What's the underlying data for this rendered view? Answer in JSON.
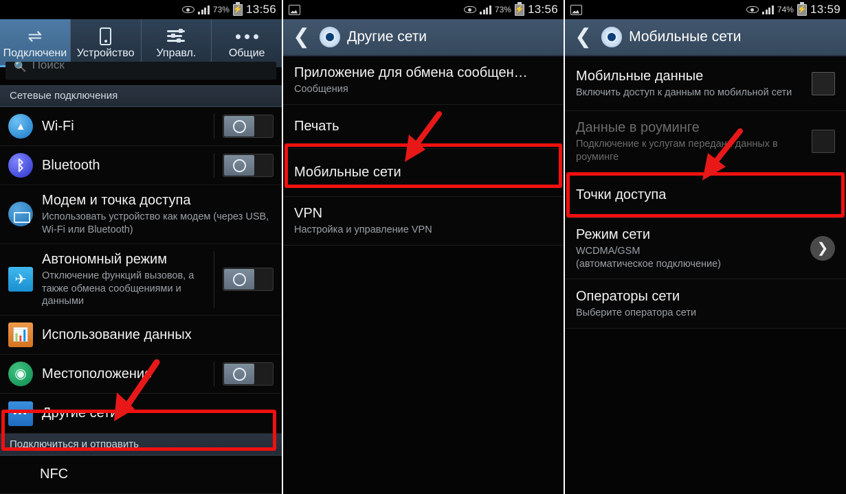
{
  "panels": [
    {
      "id": "connections",
      "status_bar": {
        "eye_icon": "eye-icon",
        "signal_icon": "signal-bars-icon",
        "battery_percent": "73%",
        "battery_icon": "battery-charging-icon",
        "time": "13:56"
      },
      "tabs": [
        {
          "label": "Подключени",
          "icon": "swap-arrows-icon",
          "active": true
        },
        {
          "label": "Устройство",
          "icon": "phone-icon",
          "active": false
        },
        {
          "label": "Управл.",
          "icon": "sliders-icon",
          "active": false
        },
        {
          "label": "Общие",
          "icon": "ellipsis-icon",
          "active": false
        }
      ],
      "search": {
        "placeholder": "Поиск",
        "icon": "search-icon"
      },
      "section_header": "Сетевые подключения",
      "rows": [
        {
          "title": "Wi-Fi",
          "sub": "",
          "icon": "wifi-icon",
          "control": "toggle",
          "state": "off"
        },
        {
          "title": "Bluetooth",
          "sub": "",
          "icon": "bluetooth-icon",
          "control": "toggle",
          "state": "off"
        },
        {
          "title": "Модем и точка доступа",
          "sub": "Использовать устройство как модем (через USB, Wi-Fi или Bluetooth)",
          "icon": "tethering-icon",
          "control": "none"
        },
        {
          "title": "Автономный режим",
          "sub": "Отключение функций вызовов, а также обмена сообщениями и данными",
          "icon": "airplane-icon",
          "control": "toggle",
          "state": "off"
        },
        {
          "title": "Использование данных",
          "sub": "",
          "icon": "data-usage-icon",
          "control": "none"
        },
        {
          "title": "Местоположение",
          "sub": "",
          "icon": "location-icon",
          "control": "toggle",
          "state": "off"
        },
        {
          "title": "Другие сети",
          "sub": "",
          "icon": "more-networks-icon",
          "control": "none",
          "highlighted": true
        }
      ],
      "section_header_2": "Подключиться и отправить",
      "rows_2": [
        {
          "title": "NFC",
          "sub": "",
          "icon": "none",
          "control": "none"
        }
      ]
    },
    {
      "id": "other-networks",
      "status_bar": {
        "image_icon": "image-notification-icon",
        "eye_icon": "eye-icon",
        "signal_icon": "signal-bars-icon",
        "battery_percent": "73%",
        "battery_icon": "battery-charging-icon",
        "time": "13:56"
      },
      "action_bar": {
        "back_icon": "back-chevron-icon",
        "app_icon": "settings-gear-icon",
        "title": "Другие сети"
      },
      "rows": [
        {
          "title": "Приложение для обмена сообщен…",
          "sub": "Сообщения"
        },
        {
          "title": "Печать",
          "sub": ""
        },
        {
          "title": "Мобильные сети",
          "sub": "",
          "highlighted": true
        },
        {
          "title": "VPN",
          "sub": "Настройка и управление VPN"
        }
      ]
    },
    {
      "id": "mobile-networks",
      "status_bar": {
        "image_icon": "image-notification-icon",
        "eye_icon": "eye-icon",
        "signal_icon": "signal-bars-icon",
        "battery_percent": "74%",
        "battery_icon": "battery-charging-icon",
        "time": "13:59"
      },
      "action_bar": {
        "back_icon": "back-chevron-icon",
        "app_icon": "settings-gear-icon",
        "title": "Мобильные сети"
      },
      "rows": [
        {
          "title": "Мобильные данные",
          "sub": "Включить доступ к данным по мобильной сети",
          "control": "checkbox",
          "state": "unchecked",
          "dim": false
        },
        {
          "title": "Данные в роуминге",
          "sub": "Подключение к услугам передани данных в роуминге",
          "control": "checkbox",
          "state": "unchecked",
          "dim": true
        },
        {
          "title": "Точки доступа",
          "sub": "",
          "control": "none",
          "highlighted": true
        },
        {
          "title": "Режим сети",
          "sub": "WCDMA/GSM\n(автоматическое подключение)",
          "control": "chevron"
        },
        {
          "title": "Операторы сети",
          "sub": "Выберите оператора сети",
          "control": "none"
        }
      ]
    }
  ],
  "annotations": {
    "highlight_color": "#f01010",
    "arrow_color": "#e81818",
    "items": [
      {
        "target": "Другие сети",
        "panel": "connections"
      },
      {
        "target": "Мобильные сети",
        "panel": "other-networks"
      },
      {
        "target": "Точки доступа",
        "panel": "mobile-networks"
      }
    ]
  }
}
